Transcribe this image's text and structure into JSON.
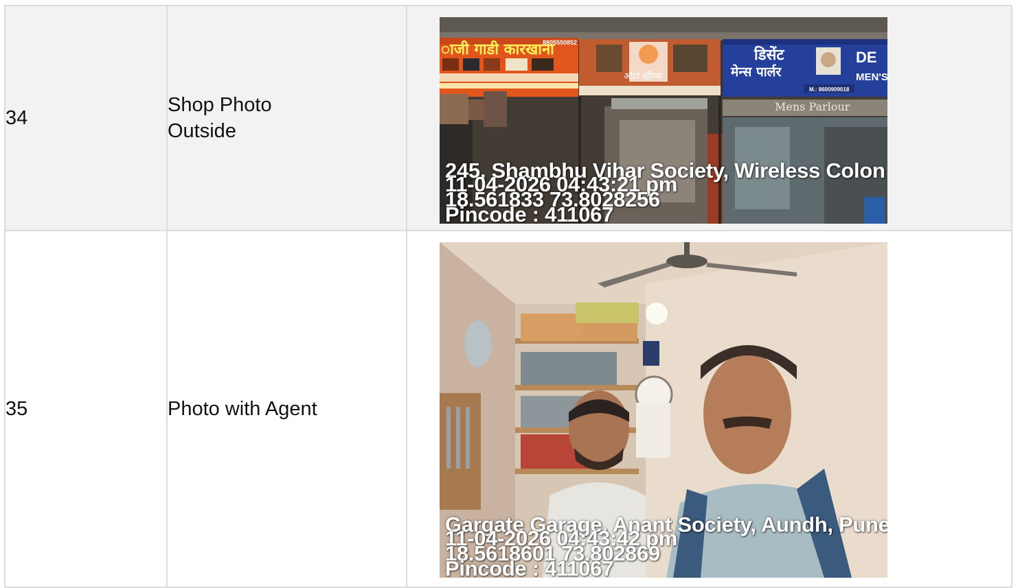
{
  "rows": [
    {
      "number": "34",
      "label": "Shop Photo Outside",
      "photo": {
        "address": "245, Shambhu Vihar Society, Wireless Colon",
        "datetime": "11-04-2026 04:43:21 pm",
        "coords": "18.561833 73.8028256",
        "pincode": "Pincode : 411067",
        "signs": {
          "left_top": "8805550852",
          "left_title": "ाजी गाडी कारखाना",
          "middle_title": "ऑटो व्हील्स",
          "right_title": "डिसेंट",
          "right_sub": "मेन्स पार्लर",
          "right_en": "DE",
          "right_en2": "MEN'S",
          "right_phone": "M.: 8600909018",
          "mens_parlour": "Mens Parlour"
        }
      }
    },
    {
      "number": "35",
      "label": "Photo with Agent",
      "photo": {
        "address": "Gargate Garage, Anant Society, Aundh, Pune",
        "datetime": "11-04-2026 04:43:42 pm",
        "coords": "18.5618601 73.802869",
        "pincode": "Pincode : 411067"
      }
    }
  ]
}
